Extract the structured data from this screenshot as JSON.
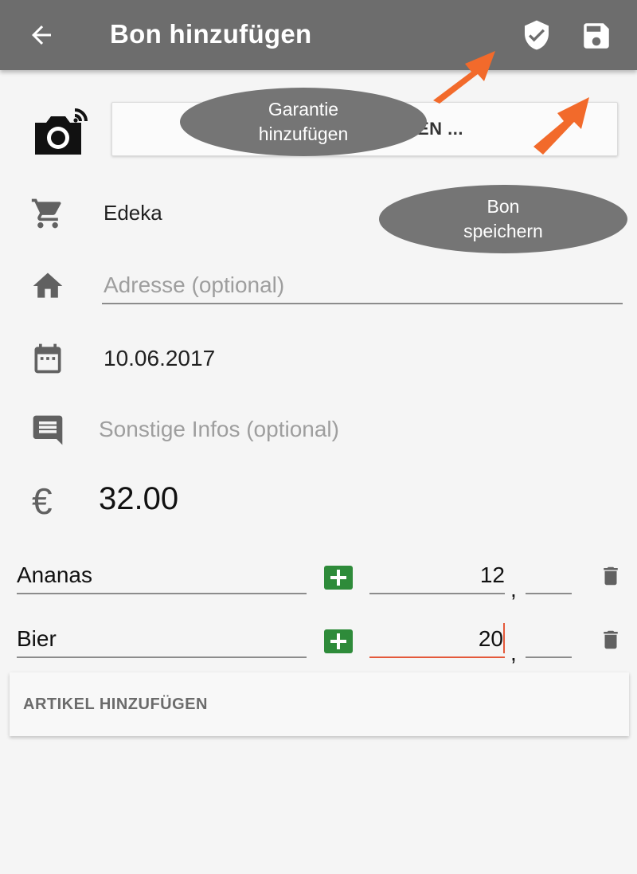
{
  "colors": {
    "appbar": "#6d6d6d",
    "accent_orange": "#f26a2b",
    "add_green": "#2e8b3a",
    "bubble": "#757575",
    "active_underline": "#e4593a"
  },
  "appbar": {
    "title": "Bon hinzufügen",
    "icons": [
      "back-arrow-icon",
      "shield-check-icon",
      "save-icon"
    ]
  },
  "photo": {
    "button_label": "EN ...",
    "icon": "camera-icon"
  },
  "store": {
    "value": "Edeka",
    "icon": "cart-icon"
  },
  "address": {
    "placeholder": "Adresse (optional)",
    "icon": "home-icon"
  },
  "date": {
    "value": "10.06.2017",
    "icon": "calendar-icon"
  },
  "notes": {
    "placeholder": "Sonstige Infos (optional)",
    "icon": "comment-icon"
  },
  "total": {
    "symbol": "€",
    "value": "32.00"
  },
  "items": [
    {
      "name": "Ananas",
      "euros": "12",
      "cents": "",
      "separator": ","
    },
    {
      "name": "Bier",
      "euros": "20",
      "cents": "",
      "separator": ","
    }
  ],
  "add_article_label": "ARTIKEL HINZUFÜGEN",
  "annotations": {
    "warranty": {
      "line1": "Garantie",
      "line2": "hinzufügen"
    },
    "save": {
      "line1": "Bon",
      "line2": "speichern"
    }
  }
}
